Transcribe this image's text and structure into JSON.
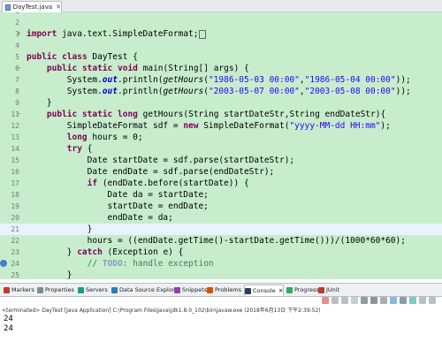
{
  "editor": {
    "tab_label": "DayTest.java",
    "tab_close": "✕",
    "lines": [
      {
        "n": "1",
        "parts": []
      },
      {
        "n": "2",
        "parts": []
      },
      {
        "n": "3",
        "fold": "+",
        "parts": [
          [
            "kw",
            "import"
          ],
          [
            "t",
            " java.text.SimpleDateFormat;"
          ]
        ],
        "import_box": true
      },
      {
        "n": "4",
        "parts": []
      },
      {
        "n": "5",
        "parts": [
          [
            "kw",
            "public"
          ],
          [
            "t",
            " "
          ],
          [
            "kw",
            "class"
          ],
          [
            "t",
            " DayTest {"
          ]
        ]
      },
      {
        "n": "6",
        "fold": "−",
        "parts": [
          [
            "t",
            "    "
          ],
          [
            "kw",
            "public"
          ],
          [
            "t",
            " "
          ],
          [
            "kw",
            "static"
          ],
          [
            "t",
            " "
          ],
          [
            "kw",
            "void"
          ],
          [
            "t",
            " main(String[] args) {"
          ]
        ]
      },
      {
        "n": "7",
        "parts": [
          [
            "t",
            "        System."
          ],
          [
            "fld",
            "out"
          ],
          [
            "t",
            ".println("
          ],
          [
            "meth",
            "getHours"
          ],
          [
            "t",
            "("
          ],
          [
            "str",
            "\"1986-05-03 00:00\""
          ],
          [
            "t",
            ","
          ],
          [
            "str",
            "\"1986-05-04 00:00\""
          ],
          [
            "t",
            "));"
          ]
        ]
      },
      {
        "n": "8",
        "parts": [
          [
            "t",
            "        System."
          ],
          [
            "fld",
            "out"
          ],
          [
            "t",
            ".println("
          ],
          [
            "meth",
            "getHours"
          ],
          [
            "t",
            "("
          ],
          [
            "str",
            "\"2003-05-07 00:00\""
          ],
          [
            "t",
            ","
          ],
          [
            "str",
            "\"2003-05-08 00:00\""
          ],
          [
            "t",
            "));"
          ]
        ]
      },
      {
        "n": "9",
        "parts": [
          [
            "t",
            "    }"
          ]
        ]
      },
      {
        "n": "11",
        "fold": "−",
        "parts": [
          [
            "t",
            "    "
          ],
          [
            "kw",
            "public"
          ],
          [
            "t",
            " "
          ],
          [
            "kw",
            "static"
          ],
          [
            "t",
            " "
          ],
          [
            "kw",
            "long"
          ],
          [
            "t",
            " getHours(String startDateStr,String endDateStr){"
          ]
        ]
      },
      {
        "n": "12",
        "parts": [
          [
            "t",
            "        SimpleDateFormat sdf = "
          ],
          [
            "kw",
            "new"
          ],
          [
            "t",
            " SimpleDateFormat("
          ],
          [
            "str",
            "\"yyyy-MM-dd HH:mm\""
          ],
          [
            "t",
            ");"
          ]
        ]
      },
      {
        "n": "13",
        "parts": [
          [
            "t",
            "        "
          ],
          [
            "kw",
            "long"
          ],
          [
            "t",
            " hours = 0;"
          ]
        ]
      },
      {
        "n": "14",
        "parts": [
          [
            "t",
            "        "
          ],
          [
            "kw",
            "try"
          ],
          [
            "t",
            " {"
          ]
        ]
      },
      {
        "n": "15",
        "parts": [
          [
            "t",
            "            Date startDate = sdf.parse(startDateStr);"
          ]
        ]
      },
      {
        "n": "16",
        "parts": [
          [
            "t",
            "            Date endDate = sdf.parse(endDateStr);"
          ]
        ]
      },
      {
        "n": "17",
        "parts": [
          [
            "t",
            "            "
          ],
          [
            "kw",
            "if"
          ],
          [
            "t",
            " (endDate.before(startDate)) {"
          ]
        ]
      },
      {
        "n": "18",
        "parts": [
          [
            "t",
            "                Date da = startDate;"
          ]
        ]
      },
      {
        "n": "19",
        "parts": [
          [
            "t",
            "                startDate = endDate;"
          ]
        ]
      },
      {
        "n": "20",
        "parts": [
          [
            "t",
            "                endDate = da;"
          ]
        ]
      },
      {
        "n": "21",
        "current": true,
        "parts": [
          [
            "t",
            "            }"
          ]
        ]
      },
      {
        "n": "22",
        "parts": [
          [
            "t",
            "            hours = ((endDate.getTime()-startDate.getTime()))/(1000*60*60);"
          ]
        ]
      },
      {
        "n": "23",
        "parts": [
          [
            "t",
            "        } "
          ],
          [
            "kw",
            "catch"
          ],
          [
            "t",
            " (Exception e) {"
          ]
        ]
      },
      {
        "n": "24",
        "marker": true,
        "parts": [
          [
            "t",
            "            "
          ],
          [
            "cmt",
            "// "
          ],
          [
            "todo",
            "TODO"
          ],
          [
            "cmt",
            ": handle exception"
          ]
        ]
      },
      {
        "n": "25",
        "parts": [
          [
            "t",
            "        }"
          ]
        ]
      },
      {
        "n": "26",
        "parts": [
          [
            "t",
            "        "
          ],
          [
            "kw",
            "return"
          ],
          [
            "t",
            " hours;"
          ]
        ]
      },
      {
        "n": "27",
        "parts": [
          [
            "t",
            "    }"
          ]
        ]
      },
      {
        "n": "28",
        "parts": [
          [
            "t",
            "}"
          ]
        ]
      },
      {
        "n": "29",
        "parts": []
      }
    ]
  },
  "views": [
    {
      "label": "Markers",
      "color": "#c0392b"
    },
    {
      "label": "Properties",
      "color": "#7f8c8d"
    },
    {
      "label": "Servers",
      "color": "#16a085"
    },
    {
      "label": "Data Source Explorer",
      "color": "#2980b9"
    },
    {
      "label": "Snippets",
      "color": "#8e44ad"
    },
    {
      "label": "Problems",
      "color": "#d35400"
    },
    {
      "label": "Console",
      "color": "#2c3e50",
      "active": true,
      "close": "✕"
    },
    {
      "label": "Progress",
      "color": "#27ae60"
    },
    {
      "label": "JUnit",
      "color": "#c0392b"
    }
  ],
  "console": {
    "header": "<terminated> DayTest [Java Application] C:\\Program Files\\Java\\jdk1.8.0_102\\bin\\javaw.exe (2018年6月13日 下午2:39:52)",
    "output": [
      "24",
      "24"
    ]
  },
  "colors": {
    "editor_background": "#c7edcc",
    "keyword": "#7f0055",
    "string": "#2a00ff",
    "field": "#0000c0",
    "comment": "#3f7f5f"
  }
}
